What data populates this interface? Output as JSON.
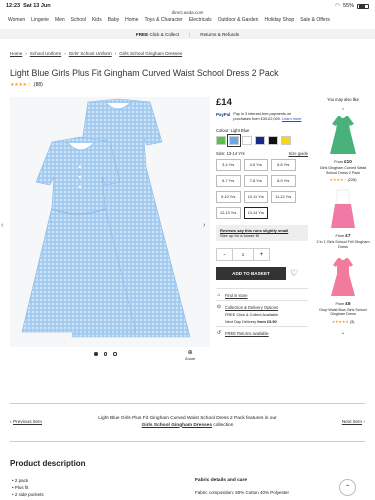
{
  "status": {
    "time": "12:23",
    "date": "Sat 13 Jun",
    "battery": "55%"
  },
  "url": "direct.asda.com",
  "nav": [
    "Women",
    "Lingerie",
    "Men",
    "School",
    "Kids",
    "Baby",
    "Home",
    "Toys & Character",
    "Electricals",
    "Outdoor & Garden",
    "Holiday Shop",
    "Sale & Offers"
  ],
  "banner": {
    "free_label": "FREE",
    "cc": "Click & Collect",
    "sep": "|",
    "returns": "Returns & Refunds"
  },
  "breadcrumb": [
    "Home",
    "School Uniform",
    "Girls' School Uniform",
    "Girls School Gingham Dresses"
  ],
  "product": {
    "title": "Light Blue Girls Plus Fit Gingham Curved Waist School Dress 2 Pack",
    "stars": "★★★★☆",
    "reviews": "(88)",
    "rating": 4,
    "price": "£14",
    "paypal": {
      "logo": "PayPal",
      "text": "Pay in 3 interest-free payments on purchases from £30-£2,000.",
      "link": "Learn more"
    },
    "colour_label": "Colour: Light Blue",
    "swatch_colors": [
      "#5bbf4a",
      "#6aa8e8",
      "#ffffff",
      "#1b2a8a",
      "#111111",
      "#f2d91a"
    ],
    "size_label": "Size: 13-14 Yrs",
    "size_guide": "Size guide",
    "sizes": [
      "3-4 Yrs",
      "4-5 Yrs",
      "5-6 Yrs",
      "6-7 Yrs",
      "7-8 Yrs",
      "8-9 Yrs",
      "9-10 Yrs",
      "10-11 Yrs",
      "11-12 Yrs",
      "12-13 Yrs",
      "13-14 Yrs"
    ],
    "fit_title": "Reviews say this runs slightly small",
    "fit_advice": "Size up for a looser fit",
    "qty_minus": "-",
    "qty": "1",
    "qty_plus": "+",
    "add_to_basket": "ADD TO BASKET",
    "find_in_store": "Find in store",
    "delivery_title": "Collection & Delivery Options",
    "delivery_line1": "FREE Click & Collect Available",
    "delivery_line2_a": "Next Day Delivery ",
    "delivery_line2_b": "from £5.50",
    "returns": "FREE Returns available"
  },
  "side": {
    "title": "You may also like",
    "items": [
      {
        "price_prefix": "From ",
        "price": "£10",
        "name": "Girls Gingham Curved Waist School Dress 2 Pack",
        "stars": "★★★★☆",
        "reviews": "(228)",
        "color": "#49b27a"
      },
      {
        "price_prefix": "From ",
        "price": "£7",
        "name": "2 In 1 Girls School Frill Gingham Dress",
        "stars": "",
        "reviews": "",
        "color": "#f07aa6"
      },
      {
        "price_prefix": "From ",
        "price": "£6",
        "name": "Drop Waist Bow Girls School Gingham Dress",
        "stars": "★★★★★",
        "reviews": "(3)",
        "color": "#f27a9b"
      }
    ]
  },
  "pager": {
    "prev": "Previous item",
    "text": "Light Blue Girls Plus Fit Gingham Curved Waist School Dress 2 Pack features in our",
    "link": "Girls School Gingham Dresses",
    "suffix": "collection",
    "next": "Next item"
  },
  "description": {
    "title": "Product description",
    "bullets": [
      "2 pack",
      "Plus fit",
      "2 side pockets"
    ],
    "fabric_title": "Fabric details and care",
    "fabric_line": "Fabric composition: 60% Cotton 40% Polyester"
  },
  "zoom_label": "Zoom"
}
